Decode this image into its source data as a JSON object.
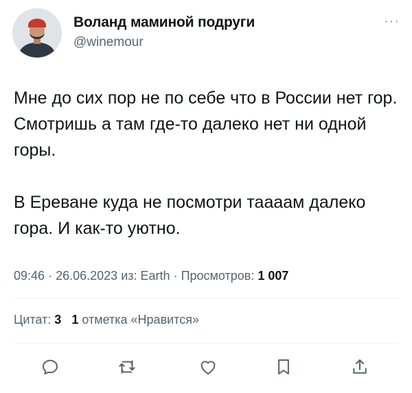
{
  "tweet": {
    "display_name": "Воланд маминой подруги",
    "handle": "@winemour",
    "more_label": "···",
    "text_paragraphs": [
      "Мне до сих пор не по себе что в России нет гор. Смотришь а там где-то далеко нет ни одной горы.",
      "В Ереване куда не посмотри таааам далеко гора. И как-то уютно."
    ],
    "time": "09:46",
    "date": "26.06.2023",
    "source_prefix": "из:",
    "source": "Earth",
    "views_label": "Просмотров:",
    "views": "1 007",
    "separator": "·"
  },
  "stats": {
    "quotes_label": "Цитат:",
    "quotes_count": "3",
    "likes_count": "1",
    "likes_label": "отметка «Нравится»"
  },
  "actions": [
    "reply-icon",
    "retweet-icon",
    "like-icon",
    "bookmark-icon",
    "share-icon"
  ],
  "colors": {
    "text": "#0f1419",
    "secondary": "#536471",
    "divider": "#eff3f4",
    "icon": "#536471"
  }
}
